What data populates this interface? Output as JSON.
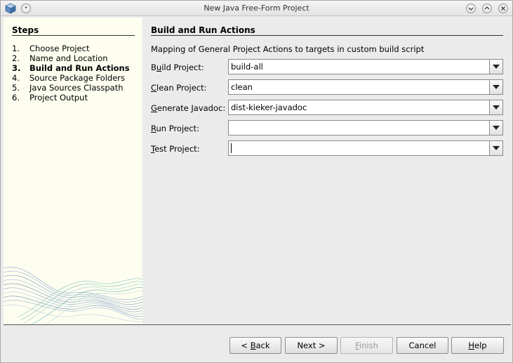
{
  "window": {
    "title": "New Java Free-Form Project",
    "title_buttons": [
      "minimize-icon",
      "maximize-icon",
      "close-icon"
    ]
  },
  "steps": {
    "title": "Steps",
    "items": [
      {
        "num": "1.",
        "label": "Choose Project"
      },
      {
        "num": "2.",
        "label": "Name and Location"
      },
      {
        "num": "3.",
        "label": "Build and Run Actions",
        "current": true
      },
      {
        "num": "4.",
        "label": "Source Package Folders"
      },
      {
        "num": "5.",
        "label": "Java Sources Classpath"
      },
      {
        "num": "6.",
        "label": "Project Output"
      }
    ]
  },
  "main": {
    "title": "Build and Run Actions",
    "description": "Mapping of General Project Actions to targets in custom build script",
    "fields": [
      {
        "mnemonic": "u",
        "pre": "B",
        "post": "ild Project:",
        "value": "build-all"
      },
      {
        "mnemonic": "C",
        "pre": "",
        "post": "lean Project:",
        "value": "clean"
      },
      {
        "mnemonic": "G",
        "pre": "",
        "post": "enerate Javadoc:",
        "value": "dist-kieker-javadoc"
      },
      {
        "mnemonic": "R",
        "pre": "",
        "post": "un Project:",
        "value": ""
      },
      {
        "mnemonic": "T",
        "pre": "",
        "post": "est Project:",
        "value": ""
      }
    ]
  },
  "buttons": {
    "back": {
      "pre": "< ",
      "mnemonic": "B",
      "post": "ack"
    },
    "next": {
      "label": "Next >"
    },
    "finish": {
      "mnemonic": "F",
      "post": "inish",
      "enabled": false
    },
    "cancel": {
      "label": "Cancel"
    },
    "help": {
      "mnemonic": "H",
      "post": "elp"
    }
  }
}
